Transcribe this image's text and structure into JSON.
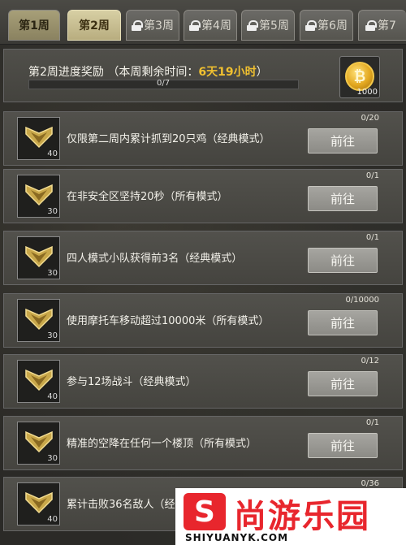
{
  "tabs": [
    {
      "label": "第1周",
      "locked": false
    },
    {
      "label": "第2周",
      "locked": false
    },
    {
      "label": "第3周",
      "locked": true
    },
    {
      "label": "第4周",
      "locked": true
    },
    {
      "label": "第5周",
      "locked": true
    },
    {
      "label": "第6周",
      "locked": true
    },
    {
      "label": "第7",
      "locked": true
    }
  ],
  "header": {
    "title_prefix": "第2周进度奖励 （本周剩余时间：",
    "days": "6天",
    "hours": "19小时",
    "title_suffix": "）",
    "progress_text": "0/7",
    "progress": 0,
    "reward_count": "1000",
    "reward_icon": "coin-icon"
  },
  "tasks": [
    {
      "desc": "仅限第二周内累计抓到20只鸡（经典模式）",
      "count": "0/20",
      "points": "40",
      "button": "前往"
    },
    {
      "desc": "在非安全区坚持20秒（所有模式）",
      "count": "0/1",
      "points": "30",
      "button": "前往"
    },
    {
      "desc": "四人模式小队获得前3名（经典模式）",
      "count": "0/1",
      "points": "30",
      "button": "前往"
    },
    {
      "desc": "使用摩托车移动超过10000米（所有模式）",
      "count": "0/10000",
      "points": "30",
      "button": "前往"
    },
    {
      "desc": "参与12场战斗（经典模式）",
      "count": "0/12",
      "points": "40",
      "button": "前往"
    },
    {
      "desc": "精准的空降在任何一个楼顶（所有模式）",
      "count": "0/1",
      "points": "30",
      "button": "前往"
    },
    {
      "desc": "累计击败36名敌人（经",
      "count": "0/36",
      "points": "40",
      "button": "前往"
    }
  ],
  "watermark": {
    "logo": "S",
    "name": "尚游乐园",
    "url": "SHIYUANYK.COM"
  },
  "colors": {
    "accent": "#f0c030",
    "active_tab": "#d7cfa4",
    "button": "#9a9994"
  }
}
